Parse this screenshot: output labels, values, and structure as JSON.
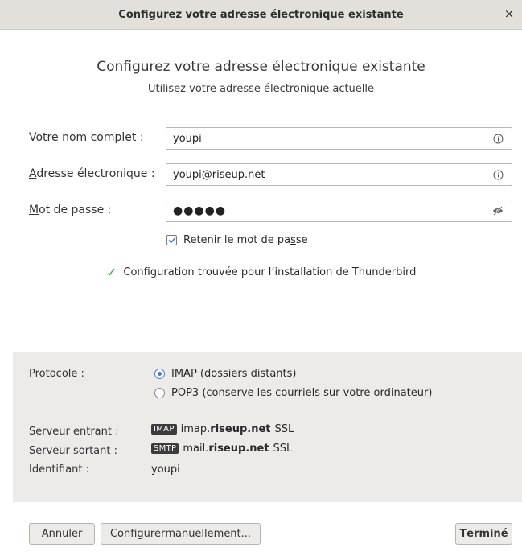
{
  "window": {
    "title": "Configurez votre adresse électronique existante",
    "close_glyph": "×"
  },
  "header": {
    "heading": "Configurez votre adresse électronique existante",
    "subheading": "Utilisez votre adresse électronique actuelle"
  },
  "form": {
    "name": {
      "label_pre": "Votre ",
      "label_key": "n",
      "label_post": "om complet :",
      "value": "youpi",
      "icon": "info-icon"
    },
    "email": {
      "label_pre": "",
      "label_key": "A",
      "label_post": "dresse électronique :",
      "value": "youpi@riseup.net",
      "icon": "info-icon"
    },
    "password": {
      "label_pre": "",
      "label_key": "M",
      "label_post": "ot de passe :",
      "value": "●●●●●",
      "icon": "eye-slash-icon"
    },
    "remember": {
      "label_pre": "Retenir le mot de pa",
      "label_key": "s",
      "label_post": "se",
      "checked": true
    }
  },
  "status": {
    "icon": "checkmark-icon",
    "text": "Configuration trouvée pour l’installation de Thunderbird",
    "color": "#2db12d"
  },
  "config": {
    "protocol_label": "Protocole :",
    "protocols": [
      {
        "label": "IMAP (dossiers distants)",
        "selected": true
      },
      {
        "label": "POP3 (conserve les courriels sur votre ordinateur)",
        "selected": false
      }
    ],
    "incoming": {
      "label": "Serveur entrant :",
      "tag": "IMAP",
      "host_pre": "imap.",
      "host_bold": "riseup.net",
      "security": "SSL"
    },
    "outgoing": {
      "label": "Serveur sortant :",
      "tag": "SMTP",
      "host_pre": "mail.",
      "host_bold": "riseup.net",
      "security": "SSL"
    },
    "username": {
      "label": "Identifiant :",
      "value": "youpi"
    }
  },
  "buttons": {
    "cancel": {
      "pre": "Ann",
      "key": "u",
      "post": "ler"
    },
    "manual": {
      "pre": "Configurer ",
      "key": "m",
      "post": "anuellement..."
    },
    "done": {
      "pre": "",
      "key": "T",
      "post": "erminé"
    }
  },
  "colors": {
    "accent": "#3b7de0",
    "titlebar": "#e3e0dc",
    "panel": "#edebe8"
  }
}
